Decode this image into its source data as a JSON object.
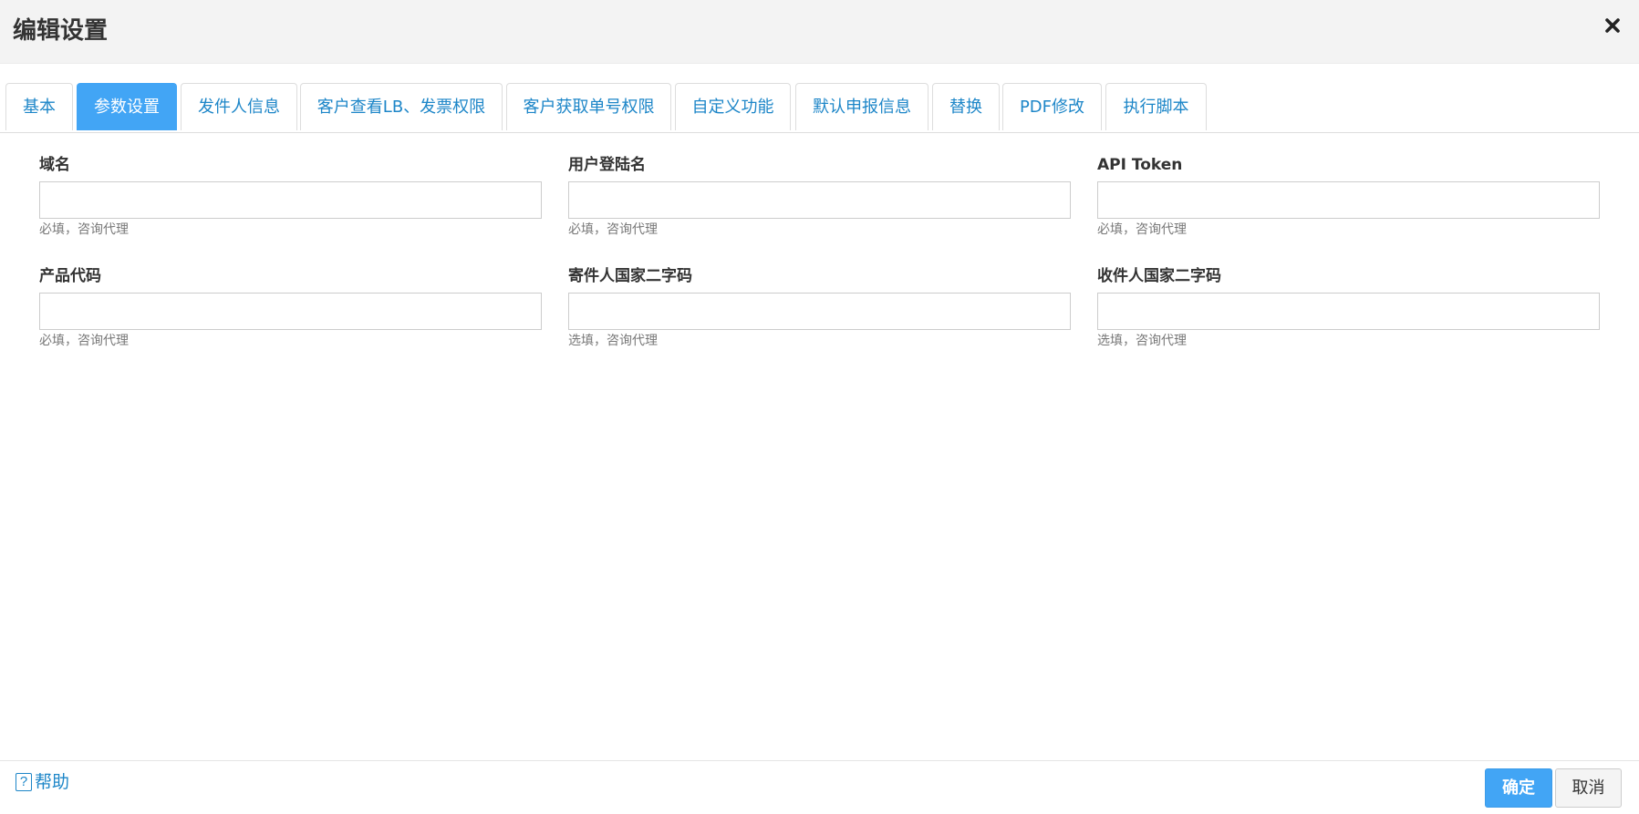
{
  "dialog": {
    "title": "编辑设置",
    "close_icon": "close-icon"
  },
  "tabs": [
    {
      "label": "基本",
      "active": false
    },
    {
      "label": "参数设置",
      "active": true
    },
    {
      "label": "发件人信息",
      "active": false
    },
    {
      "label": "客户查看LB、发票权限",
      "active": false
    },
    {
      "label": "客户获取单号权限",
      "active": false
    },
    {
      "label": "自定义功能",
      "active": false
    },
    {
      "label": "默认申报信息",
      "active": false
    },
    {
      "label": "替换",
      "active": false
    },
    {
      "label": "PDF修改",
      "active": false
    },
    {
      "label": "执行脚本",
      "active": false
    }
  ],
  "fields": [
    {
      "label": "域名",
      "value": "",
      "hint": "必填，咨询代理"
    },
    {
      "label": "用户登陆名",
      "value": "",
      "hint": "必填，咨询代理"
    },
    {
      "label": "API Token",
      "value": "",
      "hint": "必填，咨询代理"
    },
    {
      "label": "产品代码",
      "value": "",
      "hint": "必填，咨询代理"
    },
    {
      "label": "寄件人国家二字码",
      "value": "",
      "hint": "选填，咨询代理"
    },
    {
      "label": "收件人国家二字码",
      "value": "",
      "hint": "选填，咨询代理"
    }
  ],
  "footer": {
    "help_icon": "?",
    "help_label": "帮助",
    "confirm_label": "确定",
    "cancel_label": "取消"
  },
  "colors": {
    "accent": "#42a5f5",
    "link": "#1d86c8",
    "header_bg": "#f3f3f3"
  }
}
